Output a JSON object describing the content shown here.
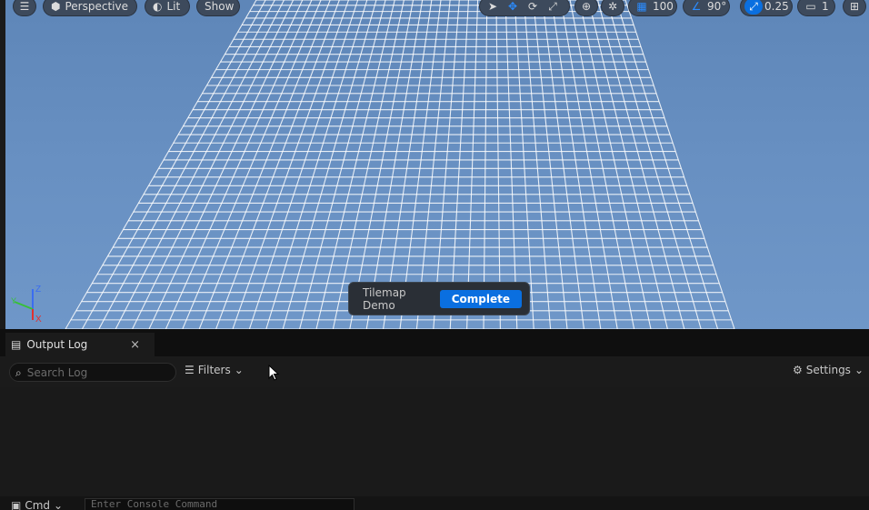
{
  "viewport": {
    "perspective_label": "Perspective",
    "lit_label": "Lit",
    "show_label": "Show",
    "grid_snap_value": "100",
    "rotation_snap_value": "90°",
    "scale_snap_value": "0.25",
    "camera_speed_value": "1",
    "axes": {
      "z": "Z",
      "y": "Y",
      "x": "X"
    }
  },
  "toast": {
    "title": "Tilemap Demo",
    "status": "Complete"
  },
  "output_log": {
    "tab_label": "Output Log",
    "close_label": "×",
    "search_placeholder": "Search Log",
    "filters_label": "Filters",
    "settings_label": "Settings",
    "cmd_label": "Cmd",
    "console_placeholder": "Enter Console Command"
  },
  "colors": {
    "accent": "#0a6fe0",
    "viewport_bg": "#6890c2",
    "panel_bg": "#1a1a1a"
  }
}
